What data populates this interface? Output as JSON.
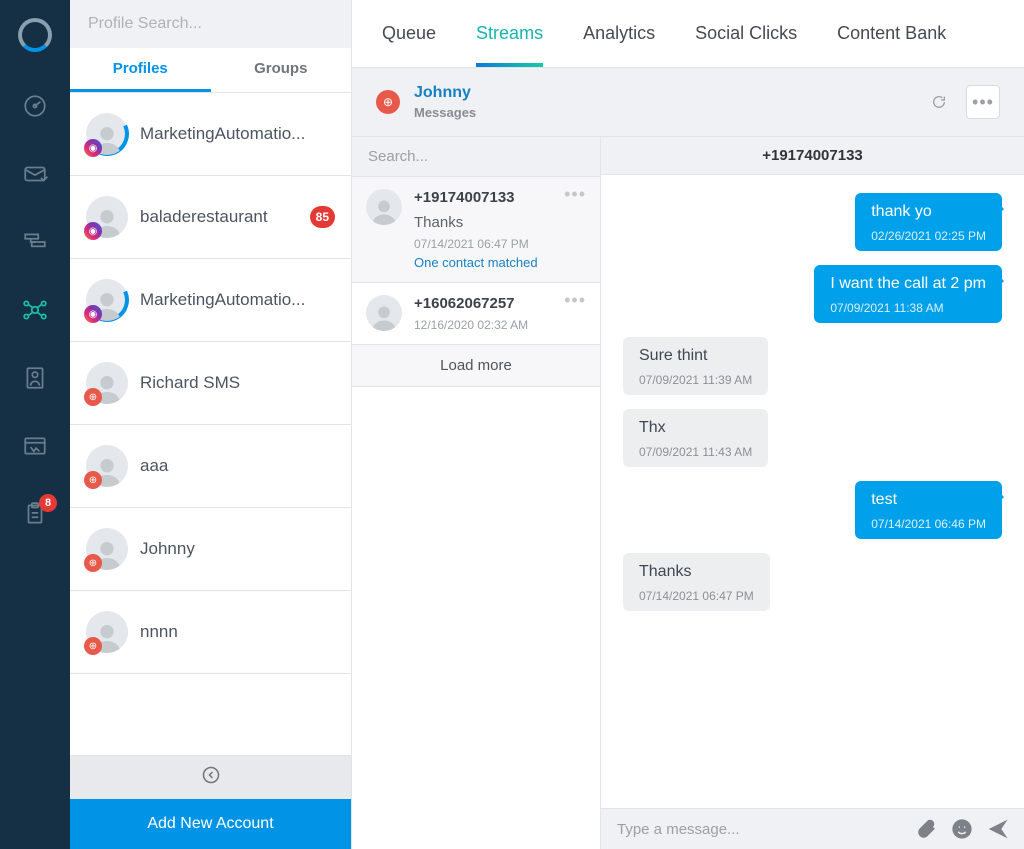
{
  "rail": {
    "badge": "8"
  },
  "profiles": {
    "search_placeholder": "Profile Search...",
    "tabs": {
      "profiles": "Profiles",
      "groups": "Groups"
    },
    "items": [
      {
        "name": "MarketingAutomatio...",
        "platform": "instagram",
        "arc": true
      },
      {
        "name": "baladerestaurant",
        "platform": "instagram",
        "arc": false,
        "badge": "85"
      },
      {
        "name": "MarketingAutomatio...",
        "platform": "instagram",
        "arc": true
      },
      {
        "name": "Richard SMS",
        "platform": "generic",
        "arc": false
      },
      {
        "name": "aaa",
        "platform": "generic",
        "arc": false
      },
      {
        "name": "Johnny",
        "platform": "generic",
        "arc": false
      },
      {
        "name": "nnnn",
        "platform": "generic",
        "arc": false
      }
    ],
    "add_account": "Add New Account"
  },
  "topnav": {
    "items": [
      "Queue",
      "Streams",
      "Analytics",
      "Social Clicks",
      "Content Bank"
    ],
    "active_index": 1
  },
  "stream": {
    "title": "Johnny",
    "subtitle": "Messages",
    "search_placeholder": "Search...",
    "active_phone": "+19174007133",
    "threads": [
      {
        "name": "+19174007133",
        "preview": "Thanks",
        "ts": "07/14/2021 06:47 PM",
        "match": "One contact matched",
        "active": true
      },
      {
        "name": "+16062067257",
        "preview": "",
        "ts": "12/16/2020 02:32 AM",
        "match": "",
        "active": false
      }
    ],
    "load_more": "Load more",
    "composer_placeholder": "Type a message..."
  },
  "messages": [
    {
      "dir": "out",
      "text": "thank yo",
      "ts": "02/26/2021 02:25 PM"
    },
    {
      "dir": "out",
      "text": "I want the call at 2 pm",
      "ts": "07/09/2021 11:38 AM"
    },
    {
      "dir": "in",
      "text": "Sure thint",
      "ts": "07/09/2021 11:39 AM"
    },
    {
      "dir": "in",
      "text": "Thx",
      "ts": "07/09/2021 11:43 AM"
    },
    {
      "dir": "out",
      "text": "test",
      "ts": "07/14/2021 06:46 PM"
    },
    {
      "dir": "in",
      "text": "Thanks",
      "ts": "07/14/2021 06:47 PM"
    }
  ]
}
